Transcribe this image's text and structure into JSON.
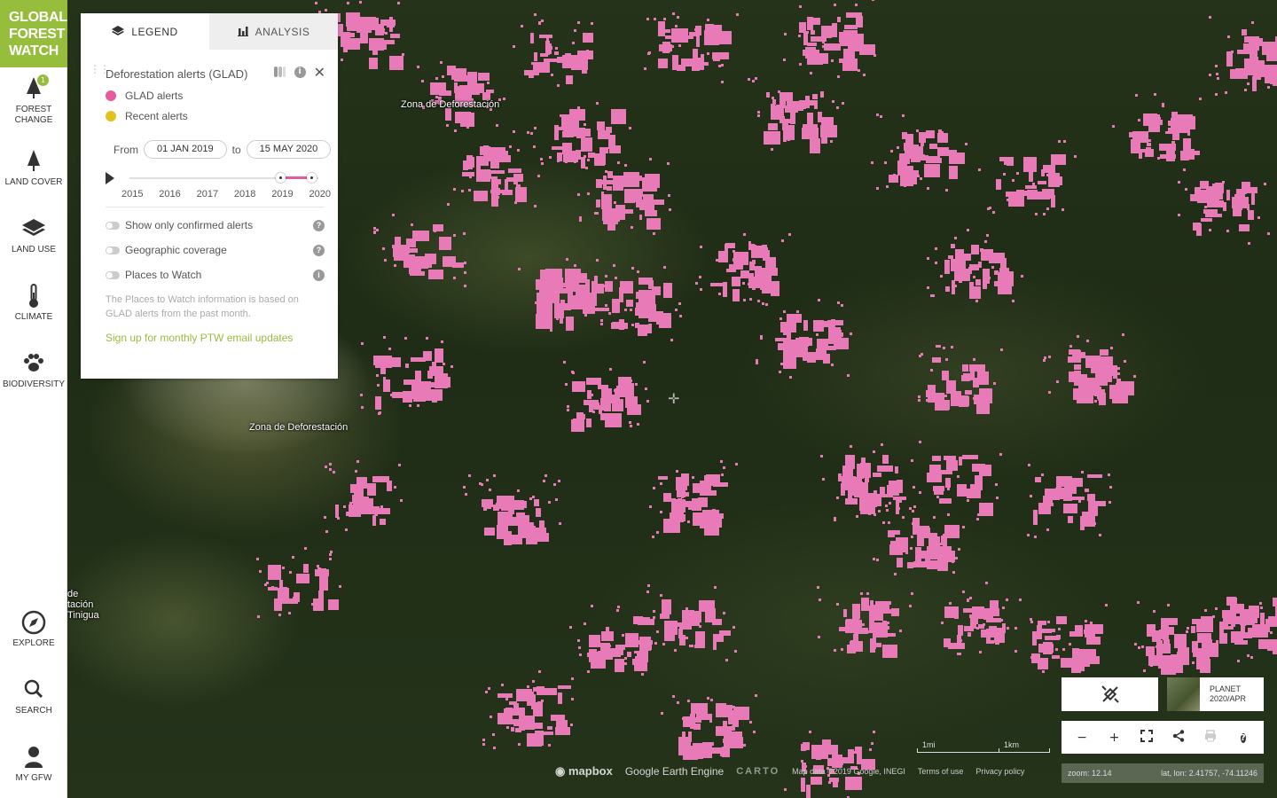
{
  "sidebar": {
    "logo": [
      "GLOBAL",
      "FOREST",
      "WATCH"
    ],
    "items": [
      {
        "label": "FOREST CHANGE",
        "icon": "tree-icon",
        "badge": "1"
      },
      {
        "label": "LAND COVER",
        "icon": "single-tree-icon"
      },
      {
        "label": "LAND USE",
        "icon": "layers-icon"
      },
      {
        "label": "CLIMATE",
        "icon": "thermometer-icon"
      },
      {
        "label": "BIODIVERSITY",
        "icon": "paw-icon"
      }
    ],
    "bottom_items": [
      {
        "label": "EXPLORE",
        "icon": "compass-icon"
      },
      {
        "label": "SEARCH",
        "icon": "search-icon"
      },
      {
        "label": "MY GFW",
        "icon": "user-icon"
      }
    ]
  },
  "panel": {
    "tabs": [
      {
        "label": "LEGEND",
        "icon": "layers-icon",
        "active": true
      },
      {
        "label": "ANALYSIS",
        "icon": "bar-chart-icon",
        "active": false
      }
    ],
    "layer": {
      "title": "Deforestation alerts (GLAD)",
      "legend": [
        {
          "label": "GLAD alerts",
          "color": "#e55b9d"
        },
        {
          "label": "Recent alerts",
          "color": "#e0c31f"
        }
      ],
      "from_label": "From",
      "from_date": "01 JAN 2019",
      "to_label": "to",
      "to_date": "15 MAY 2020",
      "years": [
        "2015",
        "2016",
        "2017",
        "2018",
        "2019",
        "2020"
      ],
      "range_start_fraction": 0.8,
      "range_end_fraction": 1.0,
      "toggles": [
        {
          "label": "Show only confirmed alerts",
          "help": "?",
          "on": false
        },
        {
          "label": "Geographic coverage",
          "help": "?",
          "on": false
        },
        {
          "label": "Places to Watch",
          "help": "i",
          "on": false
        }
      ],
      "ptw_info": "The Places to Watch information is based on GLAD alerts from the past month.",
      "ptw_link": "Sign up for monthly PTW email updates"
    }
  },
  "map": {
    "labels": [
      {
        "text": "Zona de Deforestación"
      },
      {
        "text": "Zona de Deforestación"
      },
      {
        "text": "de\ntación\nTinigua"
      }
    ],
    "alert_color": "#e87ab8",
    "basemap": {
      "name": "PLANET",
      "date": "2020/APR"
    },
    "scale": {
      "miles": "1mi",
      "km": "1km"
    },
    "attribution": {
      "mapbox": "mapbox",
      "gee": "Google Earth Engine",
      "carto": "CARTO",
      "map_data": "Map data ©2019 Google, INEGI",
      "terms": "Terms of use",
      "privacy": "Privacy policy"
    },
    "status": {
      "zoom": "zoom: 12.14",
      "coords": "lat, lon: 2.41757, -74.11246"
    }
  }
}
